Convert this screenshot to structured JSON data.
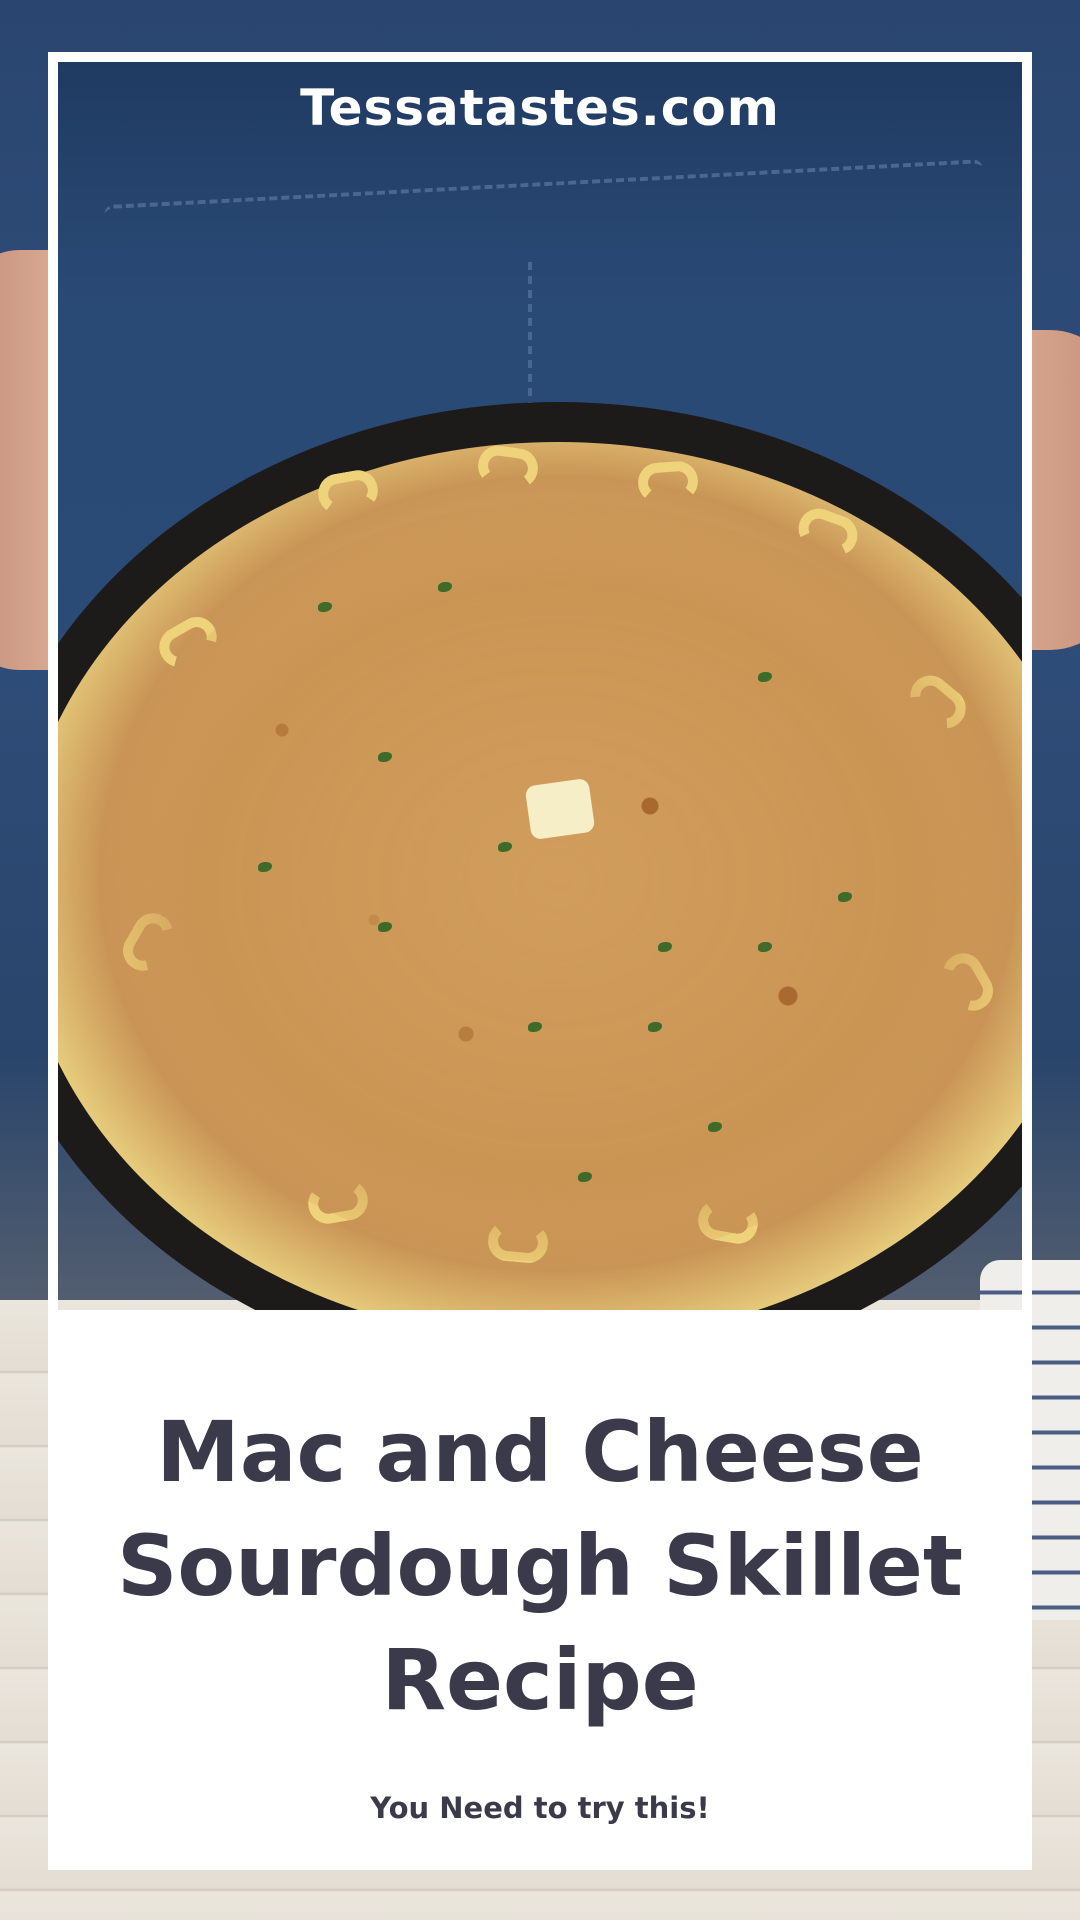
{
  "header": {
    "site_name": "Tessatastes.com"
  },
  "caption": {
    "title": "Mac and Cheese Sourdough Skillet Recipe",
    "subtitle": "You Need to try this!"
  },
  "photo": {
    "subject_icon": "skillet-mac-and-cheese-photo",
    "colors": {
      "apron": "#2a4a76",
      "crumbs": "#c99556",
      "pasta": "#efd37a",
      "skillet": "#1d1b1a",
      "parsley": "#3f6b2a"
    }
  },
  "theme": {
    "text_color": "#3a3a4a",
    "panel_color": "#ffffff"
  }
}
